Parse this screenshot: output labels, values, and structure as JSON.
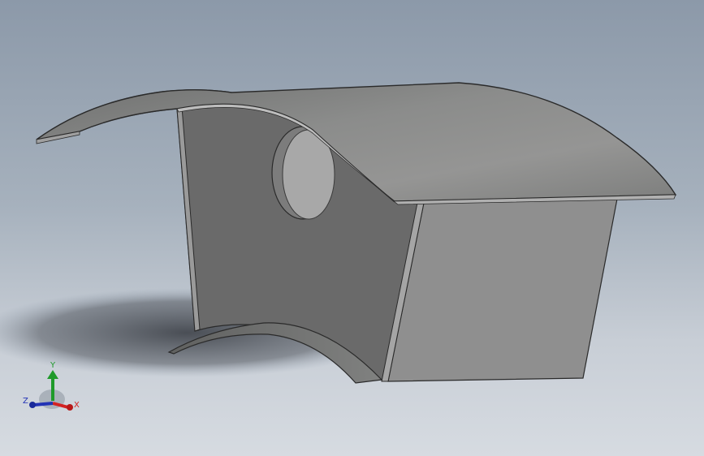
{
  "viewport": {
    "background_top": "#8c99a9",
    "background_bottom": "#d6dbe1"
  },
  "model": {
    "roof_color": "#8a8b8a",
    "wall_color": "#6a6a6a",
    "side_color": "#8f8f8f",
    "outline_color": "#2a2a2a",
    "entrance_hole": "circle"
  },
  "triad": {
    "x_label": "X",
    "y_label": "Y",
    "z_label": "Z",
    "x_color": "#d32222",
    "y_color": "#1f9a2a",
    "z_color": "#2233b5"
  }
}
